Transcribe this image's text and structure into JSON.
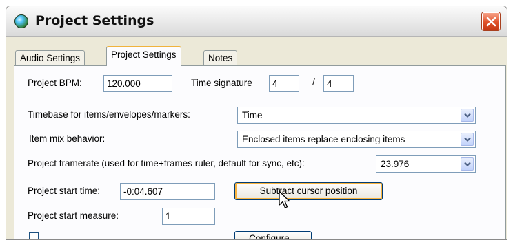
{
  "window": {
    "title": "Project Settings"
  },
  "tabs": [
    {
      "label": "Audio Settings"
    },
    {
      "label": "Project Settings"
    },
    {
      "label": "Notes"
    }
  ],
  "bpm": {
    "label": "Project BPM:",
    "value": "120.000"
  },
  "time_signature": {
    "label": "Time signature",
    "numerator": "4",
    "separator": "/",
    "denominator": "4"
  },
  "timebase": {
    "label": "Timebase for items/envelopes/markers:",
    "selected": "Time"
  },
  "item_mix": {
    "label": "Item mix behavior:",
    "selected": "Enclosed items replace enclosing items"
  },
  "framerate": {
    "label": "Project framerate (used for time+frames ruler, default for sync, etc):",
    "selected": "23.976"
  },
  "start_time": {
    "label": "Project start time:",
    "value": "-0:04.607",
    "button_label": "Subtract cursor position"
  },
  "start_measure": {
    "label": "Project start measure:",
    "value": "1"
  },
  "partial_row": {
    "button_label": "Configure..."
  },
  "colors": {
    "window_bg": "#ece9d8",
    "close_button": "#e0522a",
    "focus_ring": "#f8b33e",
    "field_border": "#7f9db9"
  }
}
